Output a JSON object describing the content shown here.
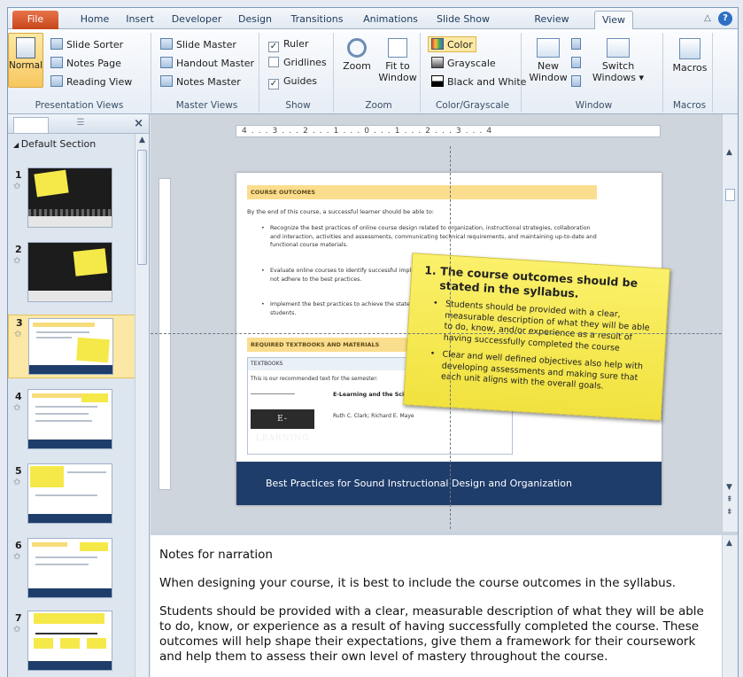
{
  "tabs": [
    "File",
    "Home",
    "Insert",
    "Developer",
    "Design",
    "Transitions",
    "Animations",
    "Slide Show",
    "Review",
    "View"
  ],
  "ribbon": {
    "presentation_views": {
      "normal": "Normal",
      "slide_sorter": "Slide Sorter",
      "notes_page": "Notes Page",
      "reading_view": "Reading View",
      "label": "Presentation Views"
    },
    "master_views": {
      "slide_master": "Slide Master",
      "handout_master": "Handout Master",
      "notes_master": "Notes Master",
      "label": "Master Views"
    },
    "show": {
      "ruler": "Ruler",
      "gridlines": "Gridlines",
      "guides": "Guides",
      "label": "Show"
    },
    "zoom": {
      "zoom": "Zoom",
      "fit_line1": "Fit to",
      "fit_line2": "Window",
      "label": "Zoom"
    },
    "color_grayscale": {
      "color": "Color",
      "grayscale": "Grayscale",
      "black_white": "Black and White",
      "label": "Color/Grayscale"
    },
    "window": {
      "new_line1": "New",
      "new_line2": "Window",
      "switch_line1": "Switch",
      "switch_line2": "Windows",
      "label": "Window"
    },
    "macros": {
      "macros": "Macros",
      "label": "Macros"
    }
  },
  "slides_pane": {
    "section": "Default Section",
    "numbers": [
      "1",
      "2",
      "3",
      "4",
      "5",
      "6",
      "7"
    ]
  },
  "slide": {
    "header": "COURSE OUTCOMES",
    "intro": "By the end of this course, a successful learner should be able to:",
    "bullet1": "Recognize the best practices of online course design related to organization, instructional strategies, collaboration and interaction, activities and assessments, communicating technical requirements, and maintaining up-to-date and functional course materials.",
    "bullet2": "Evaluate online courses to identify successful implementation of the best practices as well as components that do not adhere to the best practices.",
    "bullet3": "Implement the best practices to achieve the stated outcomes of online courses designed for post-secondary students.",
    "req_header": "REQUIRED TEXTBOOKS AND MATERIALS",
    "textbooks_header": "TEXTBOOKS",
    "textbooks_line": "This is our recommended text for the semester:",
    "book_cover": "E-LEARNING",
    "book_title": "E-Learning and the Science o",
    "book_authors": "Ruth C. Clark; Richard E. Maye",
    "footer": "Best Practices for Sound Instructional Design and Organization"
  },
  "sticky": {
    "number": "1.",
    "title": "The course outcomes should be stated in the syllabus.",
    "bullet1": "Students should be provided with a clear, measurable description of what they will be able to do, know, and/or experience as a result of having successfully completed the course",
    "bullet2": "Clear and well defined objectives also help with developing assessments and making sure that each unit aligns with the overall goals."
  },
  "ruler": {
    "marks": "4 . . . 3 . . . 2 . . . 1 . . . 0 . . . 1 . . . 2 . . . 3 . . . 4"
  },
  "notes": {
    "p1": "Notes for narration",
    "p2": "When designing your course, it is best to include the course outcomes in the syllabus.",
    "p3": "Students should be provided with a clear, measurable description of what they will be able to do, know, or experience as a result of having successfully completed the course. These outcomes will help shape their expectations, give them a framework for their coursework and help them to assess their own level of mastery throughout the course."
  }
}
